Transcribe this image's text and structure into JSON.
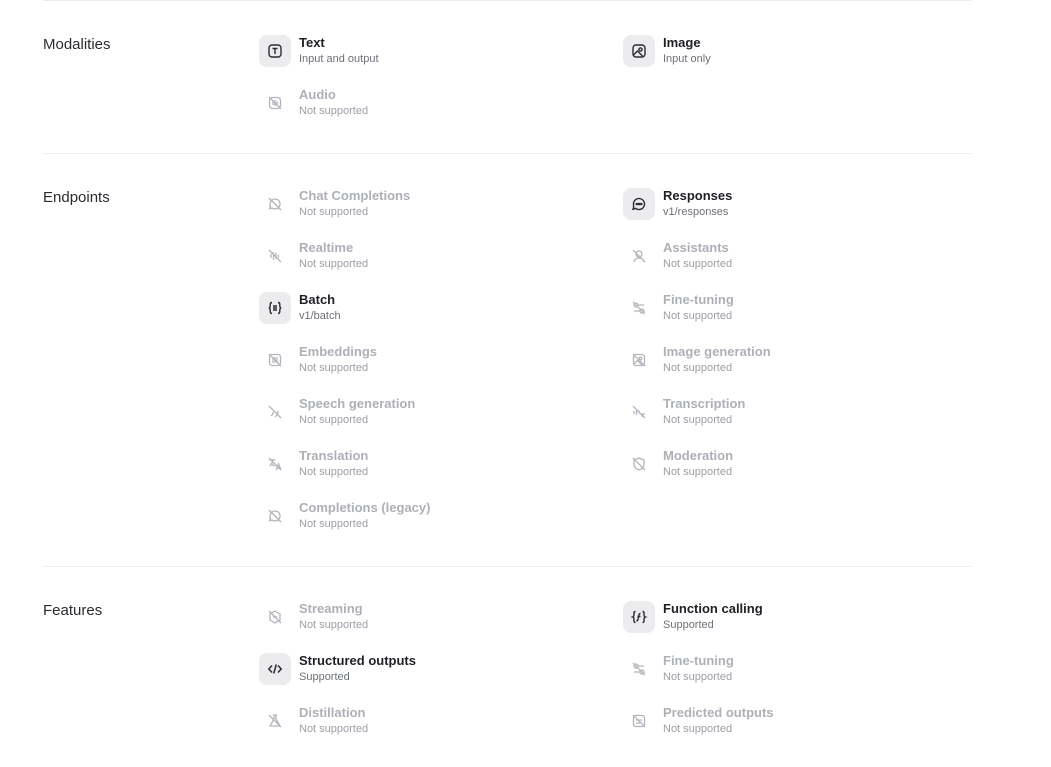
{
  "sections": {
    "modalities": {
      "title": "Modalities",
      "items": [
        {
          "name": "Text",
          "sub": "Input and output",
          "icon": "text-icon"
        },
        {
          "name": "Image",
          "sub": "Input only",
          "icon": "image-icon"
        },
        {
          "name": "Audio",
          "sub": "Not supported",
          "icon": "audio-off-icon"
        }
      ]
    },
    "endpoints": {
      "title": "Endpoints",
      "items": [
        {
          "name": "Chat Completions",
          "sub": "Not supported",
          "icon": "chat-off-icon"
        },
        {
          "name": "Responses",
          "sub": "v1/responses",
          "icon": "chat-icon"
        },
        {
          "name": "Realtime",
          "sub": "Not supported",
          "icon": "realtime-off-icon"
        },
        {
          "name": "Assistants",
          "sub": "Not supported",
          "icon": "assistants-off-icon"
        },
        {
          "name": "Batch",
          "sub": "v1/batch",
          "icon": "batch-icon"
        },
        {
          "name": "Fine-tuning",
          "sub": "Not supported",
          "icon": "fine-tuning-off-icon"
        },
        {
          "name": "Embeddings",
          "sub": "Not supported",
          "icon": "embeddings-off-icon"
        },
        {
          "name": "Image generation",
          "sub": "Not supported",
          "icon": "image-generation-off-icon"
        },
        {
          "name": "Speech generation",
          "sub": "Not supported",
          "icon": "speech-off-icon"
        },
        {
          "name": "Transcription",
          "sub": "Not supported",
          "icon": "transcription-off-icon"
        },
        {
          "name": "Translation",
          "sub": "Not supported",
          "icon": "translation-off-icon"
        },
        {
          "name": "Moderation",
          "sub": "Not supported",
          "icon": "moderation-off-icon"
        },
        {
          "name": "Completions (legacy)",
          "sub": "Not supported",
          "icon": "completions-off-icon"
        }
      ]
    },
    "features": {
      "title": "Features",
      "items": [
        {
          "name": "Streaming",
          "sub": "Not supported",
          "icon": "streaming-off-icon"
        },
        {
          "name": "Function calling",
          "sub": "Supported",
          "icon": "function-icon"
        },
        {
          "name": "Structured outputs",
          "sub": "Supported",
          "icon": "code-icon"
        },
        {
          "name": "Fine-tuning",
          "sub": "Not supported",
          "icon": "fine-tuning-off-icon"
        },
        {
          "name": "Distillation",
          "sub": "Not supported",
          "icon": "distillation-off-icon"
        },
        {
          "name": "Predicted outputs",
          "sub": "Not supported",
          "icon": "predicted-off-icon"
        }
      ]
    }
  }
}
